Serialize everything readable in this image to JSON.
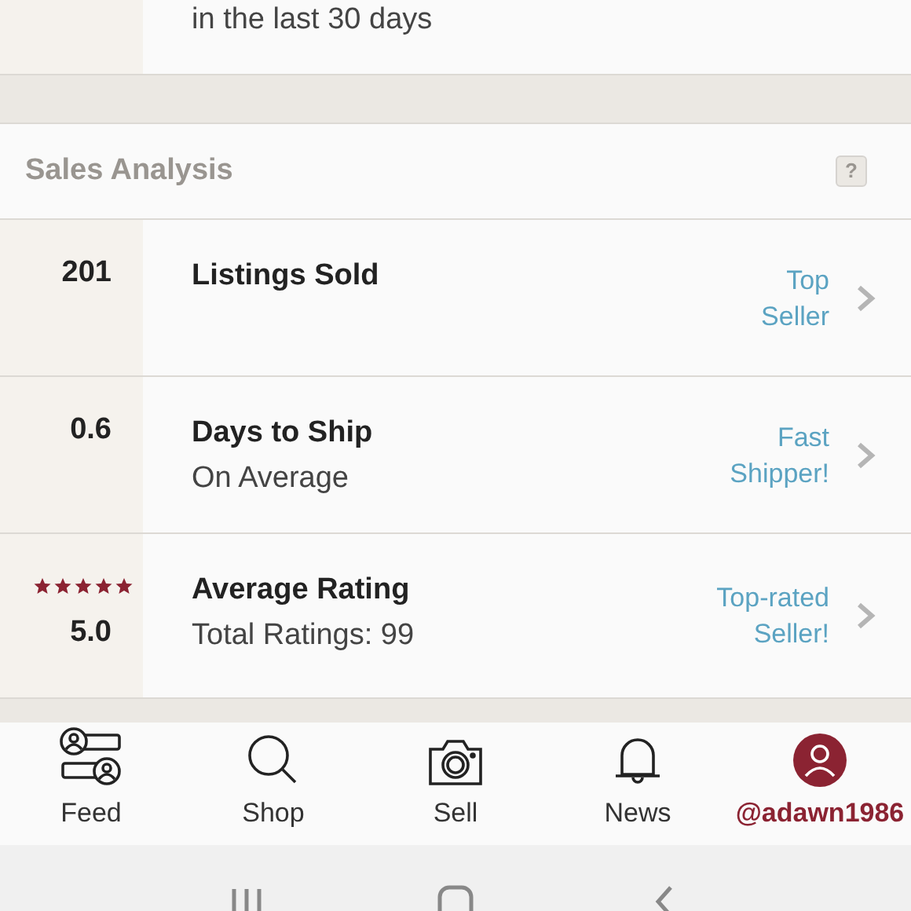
{
  "top_row": {
    "subtitle": "in the last 30 days"
  },
  "section": {
    "title": "Sales Analysis",
    "help": "?"
  },
  "stats": [
    {
      "kind": "number",
      "value": "201",
      "title": "Listings Sold",
      "badge": [
        "Top",
        "Seller"
      ]
    },
    {
      "kind": "number",
      "value": "0.6",
      "title": "Days to Ship",
      "subtitle": "On Average",
      "badge": [
        "Fast",
        "Shipper!"
      ]
    },
    {
      "kind": "rating",
      "stars": 5,
      "value": "5.0",
      "title": "Average Rating",
      "subtitle": "Total Ratings: 99",
      "badge": [
        "Top-rated",
        "Seller!"
      ]
    }
  ],
  "tab_bar": [
    {
      "kind": "feed",
      "label": "Feed",
      "selected": false
    },
    {
      "kind": "shop",
      "label": "Shop",
      "selected": false
    },
    {
      "kind": "sell",
      "label": "Sell",
      "selected": false
    },
    {
      "kind": "news",
      "label": "News",
      "selected": false
    },
    {
      "kind": "profile",
      "label": "@adawn1986",
      "selected": true
    }
  ]
}
